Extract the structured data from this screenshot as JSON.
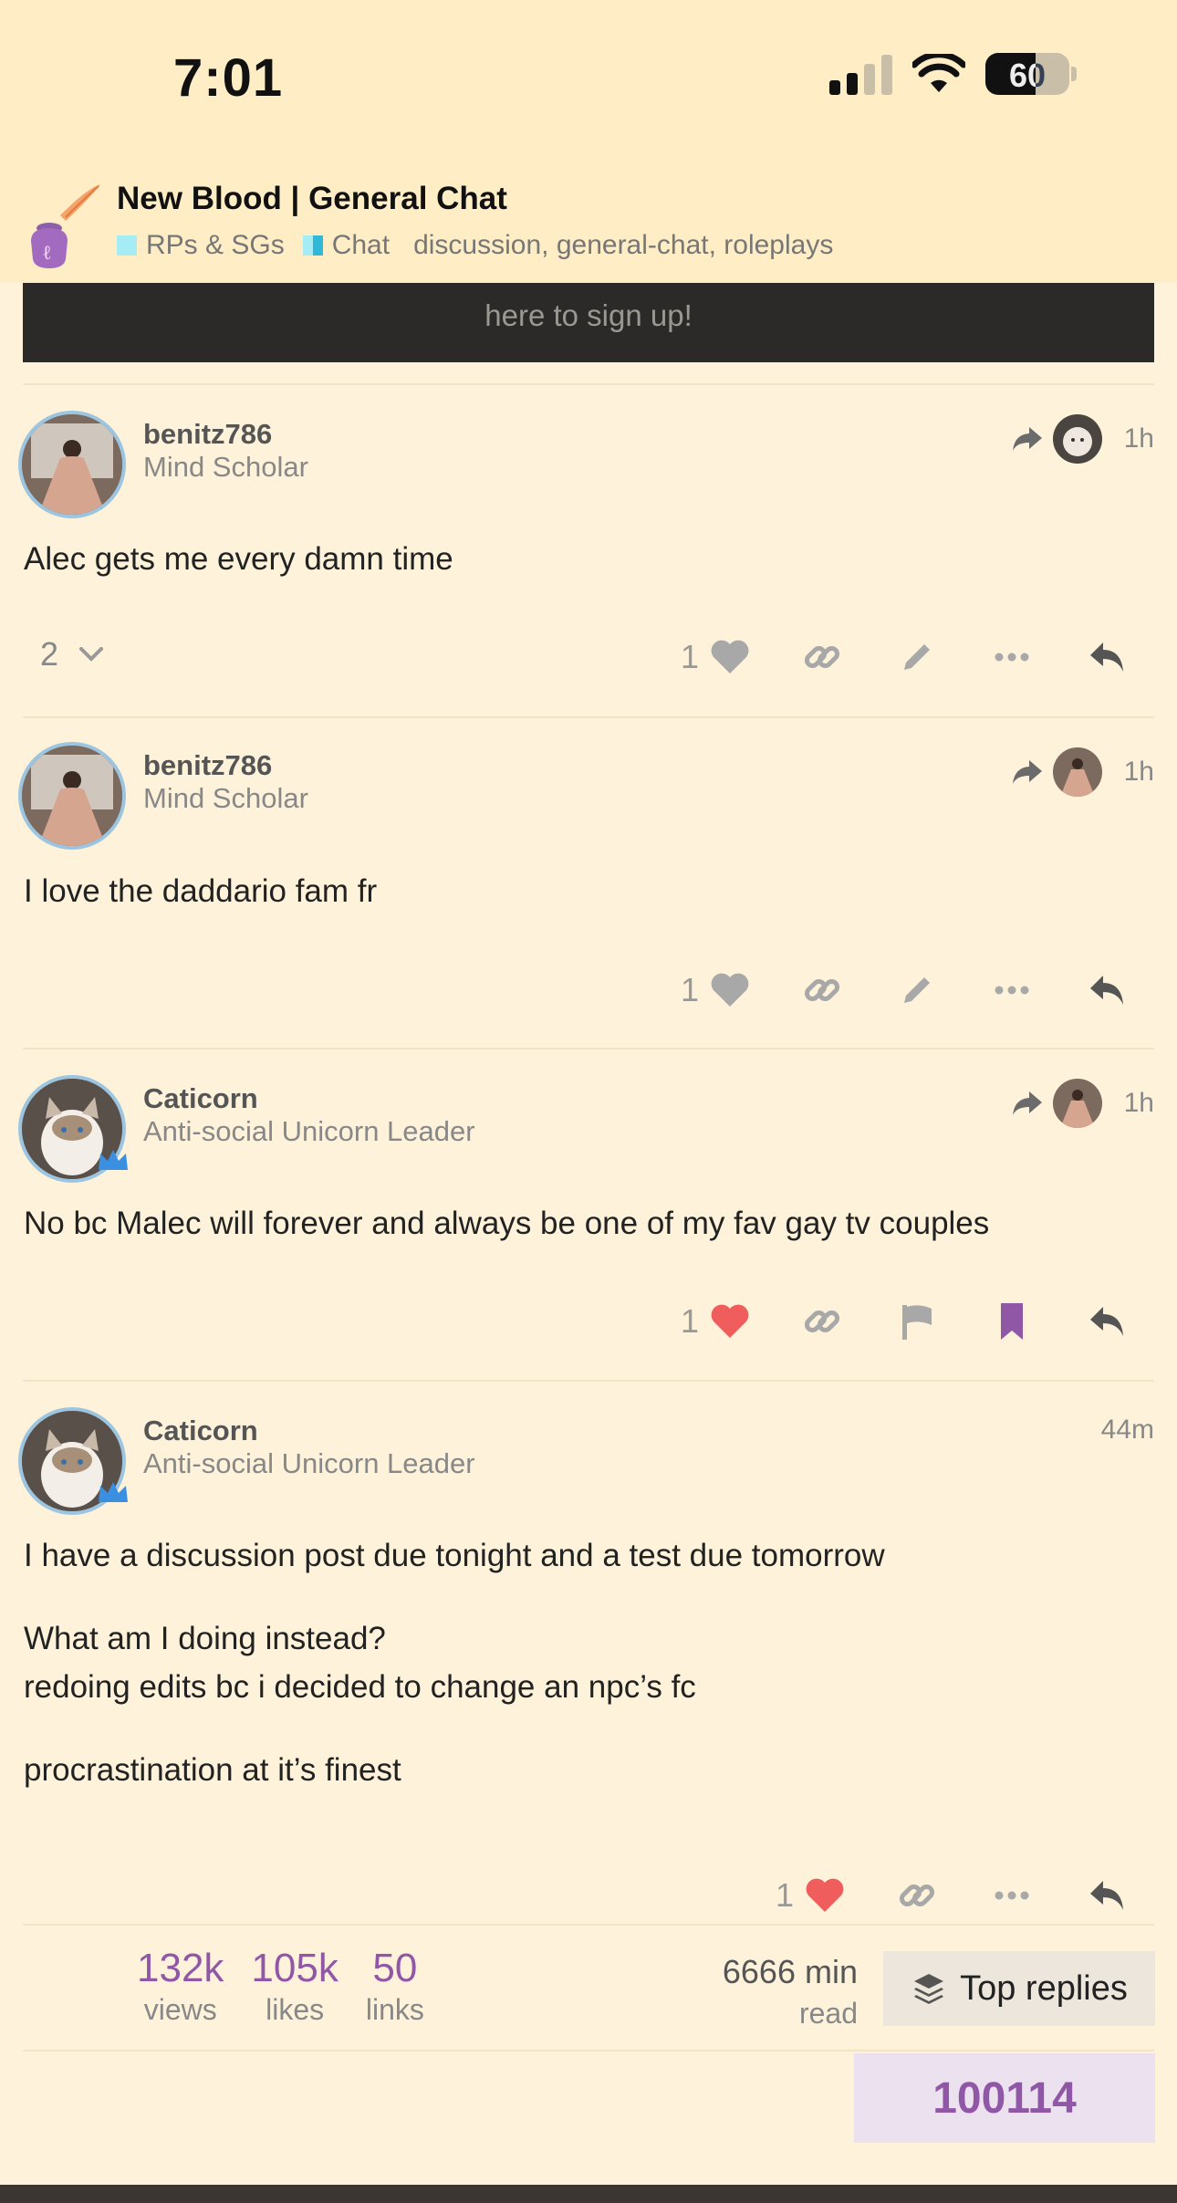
{
  "status": {
    "time": "7:01",
    "battery": "60"
  },
  "topic": {
    "title": "New Blood | General Chat",
    "categories": [
      {
        "name": "RPs & SGs",
        "color": "#a6ecf4"
      },
      {
        "name": "Chat",
        "color": "#5bd1e8"
      }
    ],
    "tags": [
      "discussion",
      "general-chat",
      "roleplays"
    ]
  },
  "banner": {
    "text": "here to sign up!"
  },
  "posts": [
    {
      "username": "benitz786",
      "user_title": "Mind Scholar",
      "age": "1h",
      "content": [
        "Alec gets me every damn time"
      ],
      "likes": "1",
      "replies_count": "2"
    },
    {
      "username": "benitz786",
      "user_title": "Mind Scholar",
      "age": "1h",
      "content": [
        "I love the daddario fam fr"
      ],
      "likes": "1"
    },
    {
      "username": "Caticorn",
      "user_title": "Anti-social Unicorn Leader",
      "age": "1h",
      "content": [
        "No bc Malec will forever and always be one of my fav gay tv couples"
      ],
      "likes": "1"
    },
    {
      "username": "Caticorn",
      "user_title": "Anti-social Unicorn Leader",
      "age": "44m",
      "content": [
        "I have a discussion post due tonight and a test due tomorrow",
        "What am I doing instead?",
        "redoing edits bc i decided to change an npc’s fc",
        "procrastination at it’s finest"
      ],
      "likes": "1"
    }
  ],
  "footer": {
    "views": {
      "value": "132k",
      "label": "views"
    },
    "likes": {
      "value": "105k",
      "label": "likes"
    },
    "links": {
      "value": "50",
      "label": "links"
    },
    "read_time": {
      "value": "6666 min",
      "label": "read"
    },
    "top_replies_label": "Top replies",
    "counter": "100114"
  },
  "colors": {
    "accent": "#9157a7",
    "like_active": "#ef6b6b",
    "background": "#fef3da"
  }
}
